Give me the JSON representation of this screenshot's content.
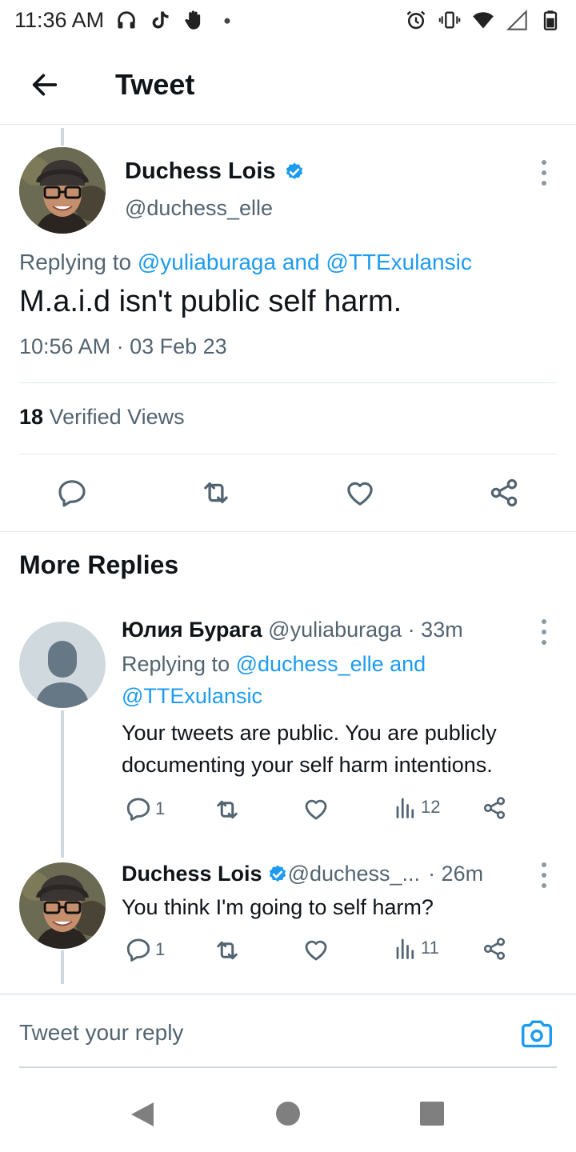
{
  "status_bar": {
    "time": "11:36 AM"
  },
  "app_bar": {
    "title": "Tweet"
  },
  "main_tweet": {
    "name": "Duchess Lois",
    "handle": "@duchess_elle",
    "replying_prefix": "Replying to ",
    "replying_user1": "@yuliaburaga",
    "replying_and": " and ",
    "replying_user2": "@TTExulansic",
    "text": "M.a.i.d isn't public self harm.",
    "timestamp": "10:56 AM · 03 Feb 23",
    "views_count": "18",
    "views_label": " Verified Views"
  },
  "more_replies_title": "More Replies",
  "replies": [
    {
      "name": "Юлия Бурага",
      "handle_time": " @yuliaburaga · 33m",
      "replying_prefix": "Replying to ",
      "replying_user1": "@duchess_elle",
      "replying_and": " and",
      "replying_user2": "@TTExulansic",
      "text": "Your tweets are public. You are publicly documenting your self harm intentions.",
      "reply_count": "1",
      "views": "12"
    },
    {
      "name": "Duchess Lois",
      "handle": " @duchess_...",
      "time": " · 26m",
      "text": "You think I'm going to self harm?",
      "reply_count": "1",
      "views": "11"
    }
  ],
  "compose": {
    "placeholder": "Tweet your reply"
  },
  "colors": {
    "accent": "#1d9bf0",
    "text_primary": "#0f1419",
    "text_secondary": "#536471",
    "divider": "#e1e8ed"
  }
}
